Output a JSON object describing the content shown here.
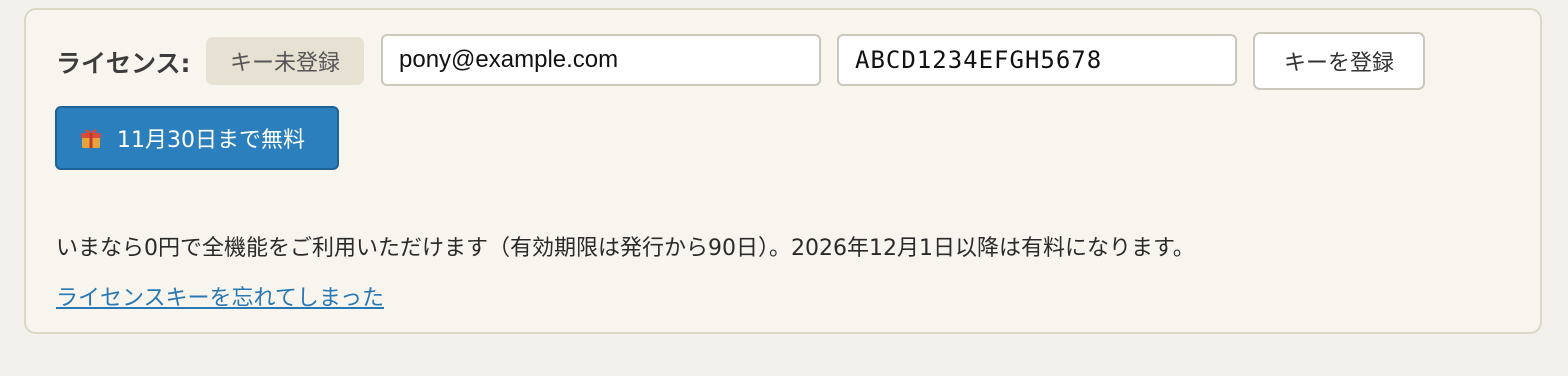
{
  "license": {
    "label": "ライセンス:",
    "status_badge": "キー未登録",
    "email_value": "pony@example.com",
    "key_value": "ABCD1234EFGH5678",
    "register_button": "キーを登録",
    "free_button": "11月30日まで無料",
    "free_button_icon": "gift-icon",
    "info_text": "いまなら0円で全機能をご利用いただけます（有効期限は発行から90日）。2026年12月1日以降は有料になります。",
    "forgot_link": "ライセンスキーを忘れてしまった"
  },
  "colors": {
    "accent_blue": "#2b7fbd",
    "link_blue": "#2878b5",
    "panel_background": "#f7f5ee",
    "badge_background": "#e6e1d3"
  }
}
